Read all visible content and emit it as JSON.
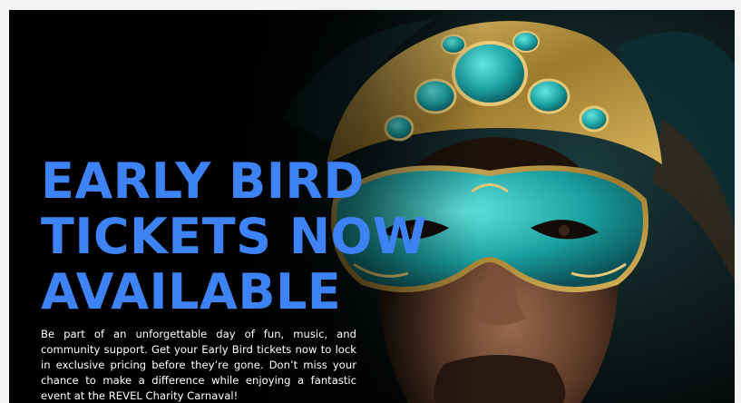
{
  "hero": {
    "headline_lines": [
      "EARLY BIRD",
      "TICKETS NOW",
      "AVAILABLE"
    ],
    "body": "Be part of an unforgettable day of fun, music, and community support. Get your Early Bird tickets now to lock in exclusive pricing before they’re gone. Don’t miss your chance to make a difference while enjoying a fantastic event at the REVEL Charity Carnaval!",
    "image": "masked-man-carnival-photo",
    "headline_color": "#3d83f5",
    "mask_colors": [
      "#1fb3b0",
      "#c9a24a"
    ]
  }
}
